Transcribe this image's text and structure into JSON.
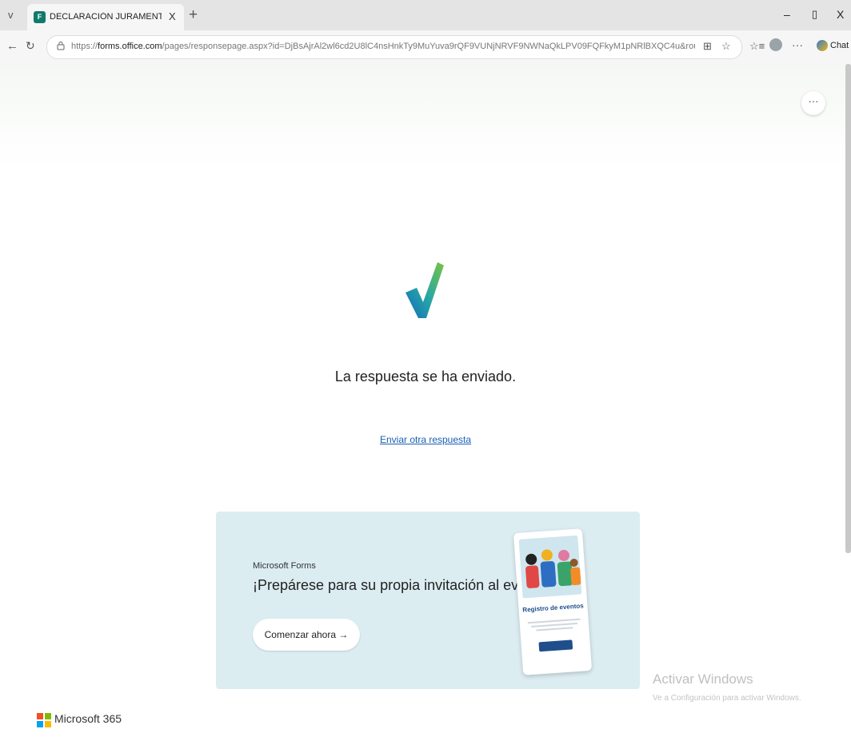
{
  "browser": {
    "tab_dropdown": "v",
    "tab": {
      "title": "DECLARACIÓN JURAMENTADA IN",
      "favicon": "F",
      "close": "X"
    },
    "new_tab": "+",
    "window": {
      "minimize": "–",
      "maximize": "▯",
      "close": "X"
    },
    "address": {
      "back": "←",
      "reload": "↻",
      "lock": "🔒",
      "url_prefix": "https://",
      "url_host": "forms.office.com",
      "url_path": "/pages/responsepage.aspx?id=DjBsAjrAl2wl6cd2U8lC4nsHnkTy9MuYuva9rQF9VUNjNRVF9NWNaQkLPV09FQFkyM1pNRlBXQC4u&rou...",
      "reader_icon": "⊞",
      "favorite_icon": "☆",
      "favorites_icon": "☆≡",
      "more": "···",
      "copilot_label": "Chat"
    }
  },
  "page": {
    "more": "···",
    "confirmation": "La respuesta se ha enviado.",
    "another_response": "Enviar otra respuesta"
  },
  "promo": {
    "brand": "Microsoft Forms",
    "title": "¡Prepárese para su propia invitación al evento!",
    "cta": "Comenzar ahora →",
    "card_title": "Registro de eventos"
  },
  "watermark": {
    "title": "Activar Windows",
    "subtitle": "Ve a Configuración para activar Windows."
  },
  "footer": {
    "brand": "Microsoft 365"
  }
}
